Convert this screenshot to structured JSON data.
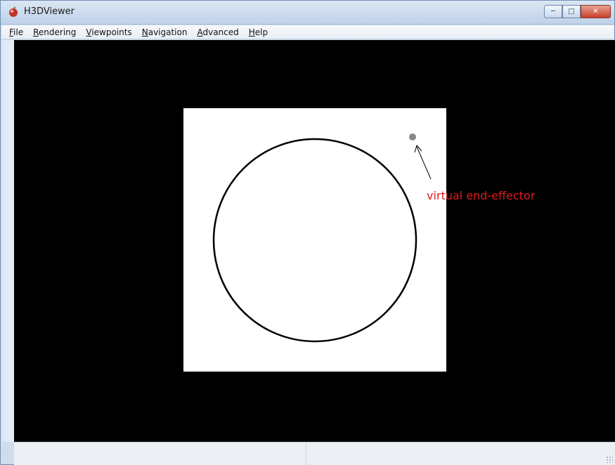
{
  "window": {
    "title": "H3DViewer",
    "app_icon": "h3d-app-icon",
    "controls": {
      "minimize_icon": "minimize-icon",
      "maximize_icon": "maximize-icon",
      "close_icon": "close-icon"
    }
  },
  "menubar": {
    "items": [
      {
        "accel": "F",
        "rest": "ile"
      },
      {
        "accel": "R",
        "rest": "endering"
      },
      {
        "accel": "V",
        "rest": "iewpoints"
      },
      {
        "accel": "N",
        "rest": "avigation"
      },
      {
        "accel": "A",
        "rest": "dvanced"
      },
      {
        "accel": "H",
        "rest": "elp"
      }
    ]
  },
  "scene": {
    "background_color": "#000000",
    "panel_color": "#ffffff",
    "circle_stroke_color": "#000000",
    "end_effector_color": "#888888",
    "annotation": {
      "label": "virtual end-effector",
      "color": "#e01b1b"
    }
  },
  "statusbar": {
    "left_text": "",
    "right_text": ""
  },
  "colors": {
    "titlebar": "#c6d7eb",
    "close_button": "#c8412b"
  }
}
